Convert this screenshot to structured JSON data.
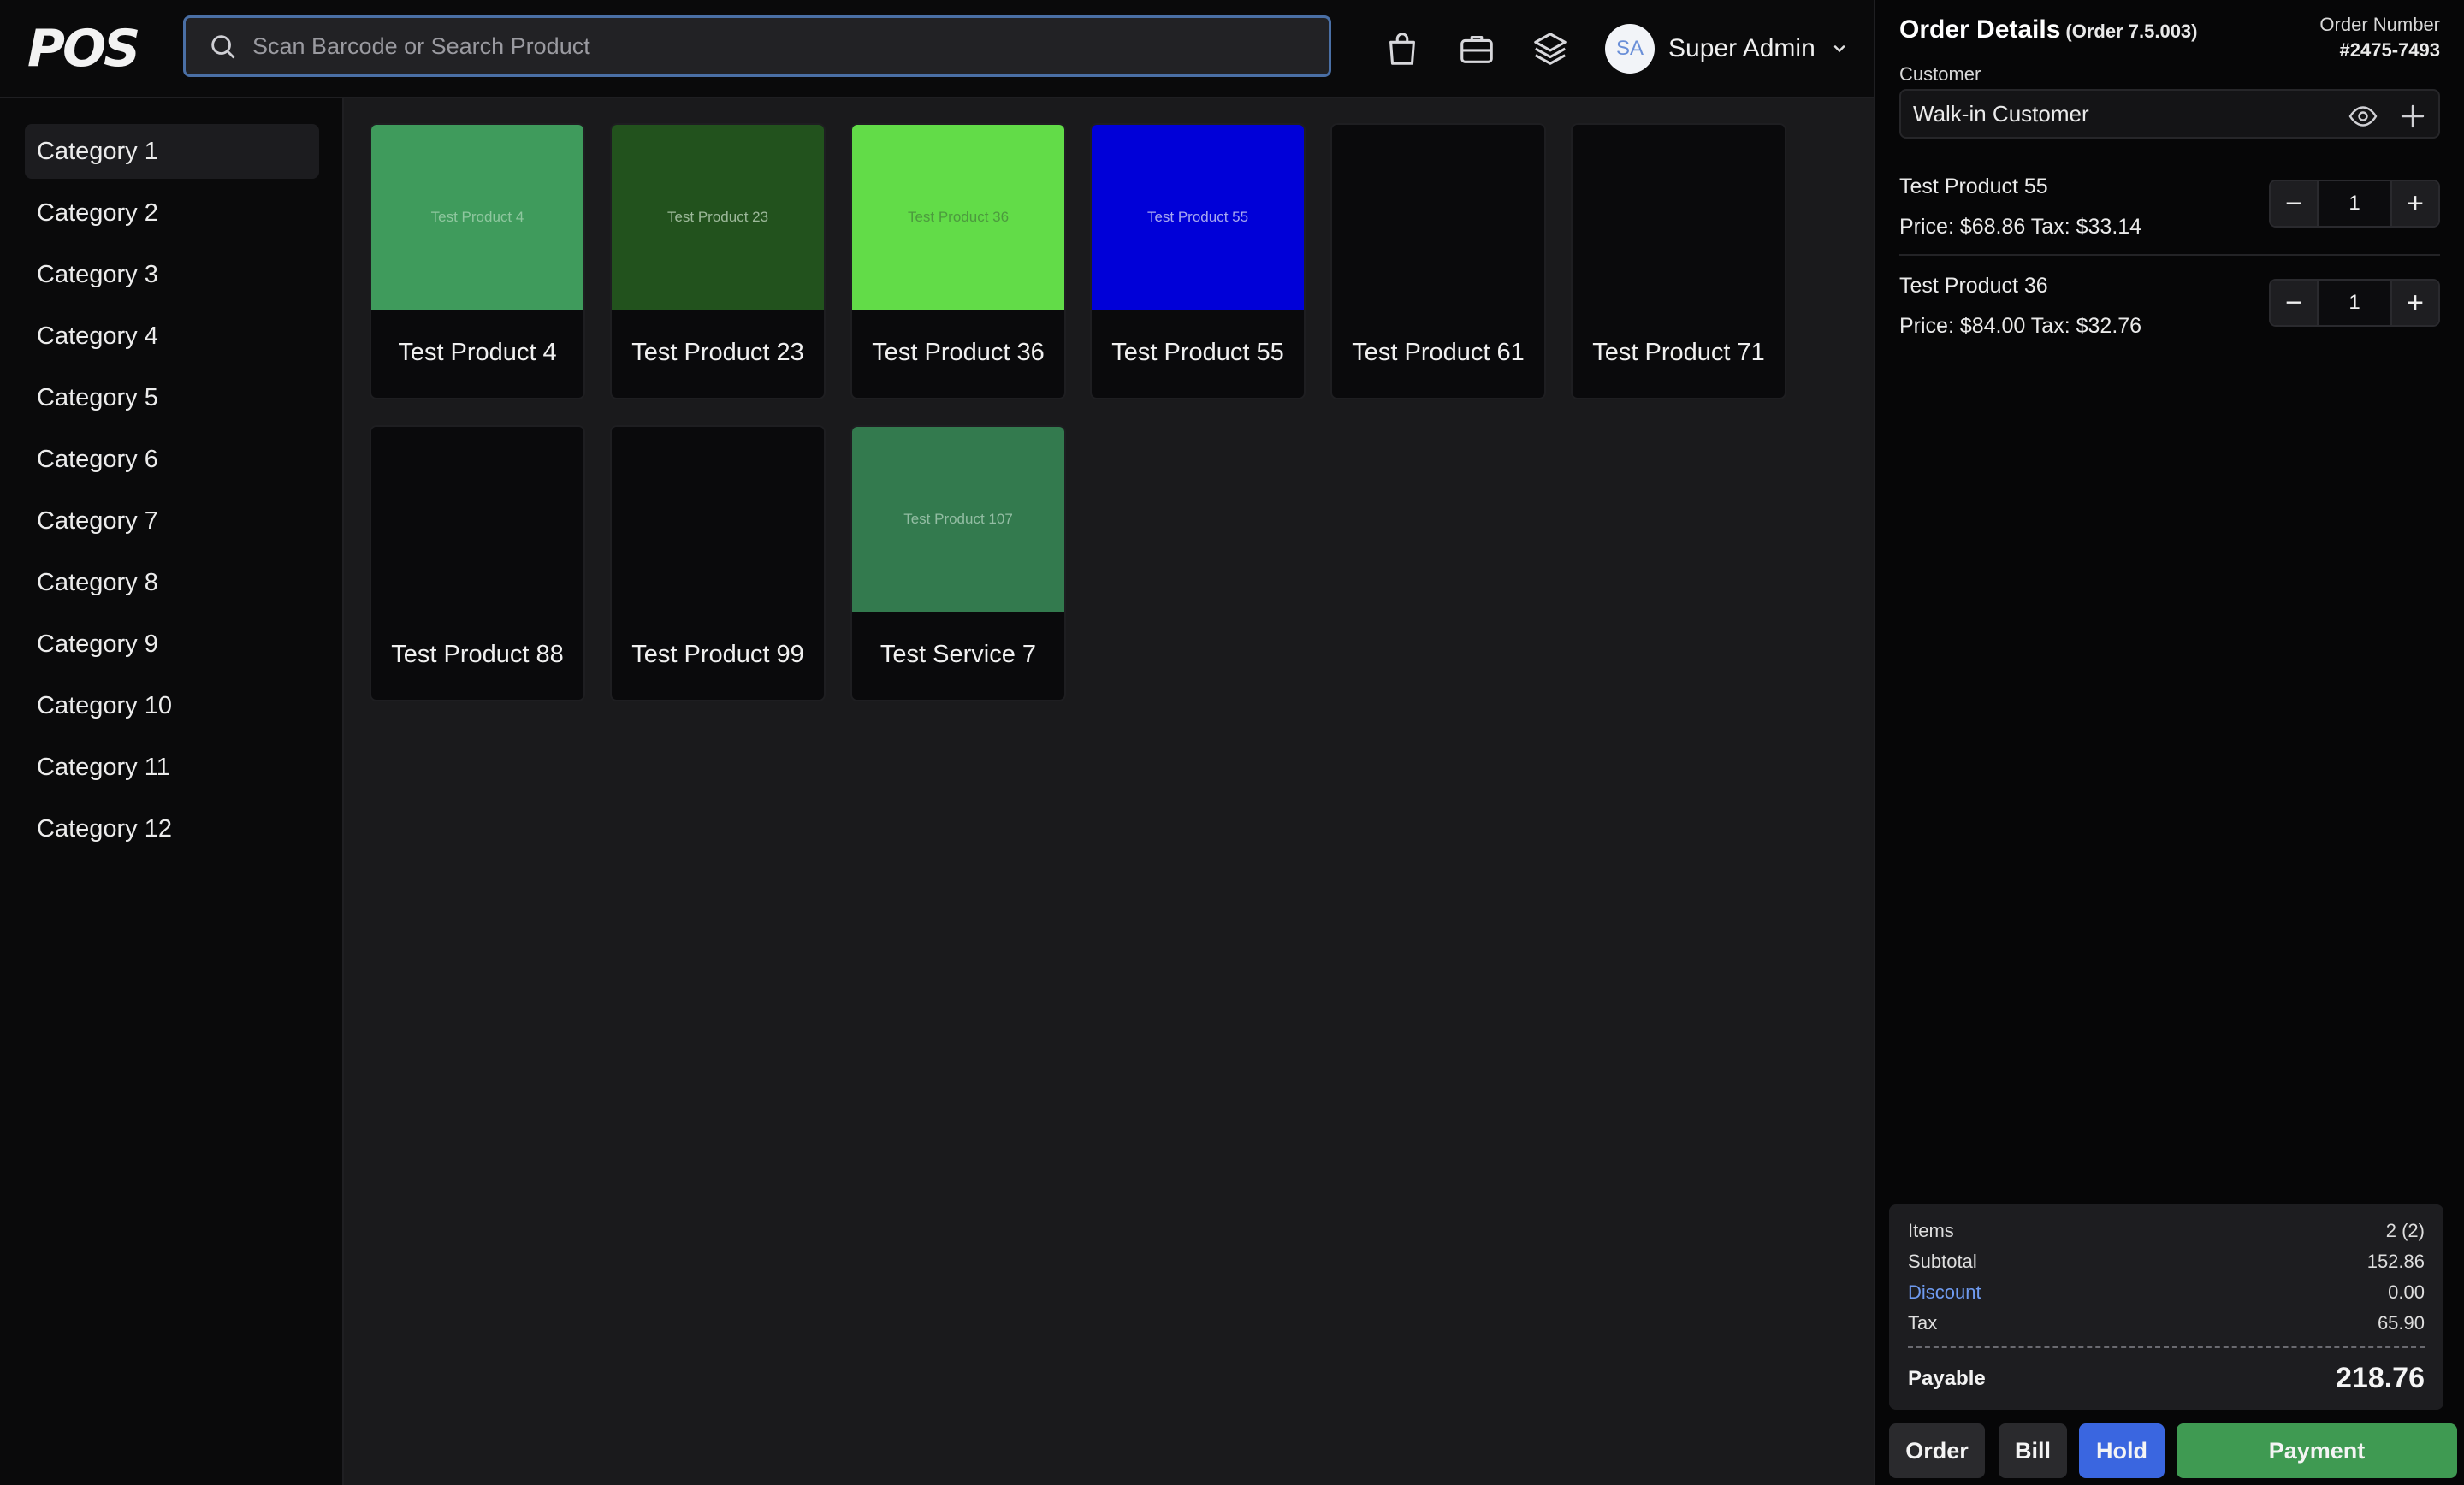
{
  "header": {
    "logo": "POS",
    "search_placeholder": "Scan Barcode or Search Product",
    "icons": [
      "shopping-bag-icon",
      "briefcase-icon",
      "layers-icon"
    ],
    "user": {
      "initials": "SA",
      "name": "Super Admin"
    }
  },
  "sidebar": {
    "categories": [
      {
        "label": "Category 1",
        "active": true
      },
      {
        "label": "Category 2"
      },
      {
        "label": "Category 3"
      },
      {
        "label": "Category 4"
      },
      {
        "label": "Category 5"
      },
      {
        "label": "Category 6"
      },
      {
        "label": "Category 7"
      },
      {
        "label": "Category 8"
      },
      {
        "label": "Category 9"
      },
      {
        "label": "Category 10"
      },
      {
        "label": "Category 11"
      },
      {
        "label": "Category 12"
      }
    ]
  },
  "products": [
    {
      "name": "Test Product 4",
      "thumb_text": "Test Product 4",
      "color": "#3f9b5c",
      "thumb_text_color": "#8fc79f"
    },
    {
      "name": "Test Product 23",
      "thumb_text": "Test Product 23",
      "color": "#22521d",
      "thumb_text_color": "#9db99a"
    },
    {
      "name": "Test Product 36",
      "thumb_text": "Test Product 36",
      "color": "#62dc48",
      "thumb_text_color": "#4c9a3e"
    },
    {
      "name": "Test Product 55",
      "thumb_text": "Test Product 55",
      "color": "#0000d8",
      "thumb_text_color": "#a8a8f0"
    },
    {
      "name": "Test Product 61",
      "thumb_text": "",
      "color": "#0a0a0c",
      "thumb_text_color": "#0a0a0c"
    },
    {
      "name": "Test Product 71",
      "thumb_text": "",
      "color": "#0a0a0c",
      "thumb_text_color": "#0a0a0c"
    },
    {
      "name": "Test Product 88",
      "thumb_text": "",
      "color": "#0a0a0c",
      "thumb_text_color": "#0a0a0c"
    },
    {
      "name": "Test Product 99",
      "thumb_text": "",
      "color": "#0a0a0c",
      "thumb_text_color": "#0a0a0c"
    },
    {
      "name": "Test Service 7",
      "thumb_text": "Test Product 107",
      "color": "#337a4e",
      "thumb_text_color": "#93bda3"
    }
  ],
  "order": {
    "title": "Order Details",
    "version": "(Order 7.5.003)",
    "number_label": "Order Number",
    "number": "#2475-7493",
    "customer_label": "Customer",
    "customer": "Walk-in Customer",
    "items": [
      {
        "name": "Test Product 55",
        "price_line": "Price: $68.86 Tax: $33.14",
        "qty": "1"
      },
      {
        "name": "Test Product 36",
        "price_line": "Price: $84.00 Tax: $32.76",
        "qty": "1"
      }
    ],
    "totals": {
      "items_label": "Items",
      "items_value": "2 (2)",
      "subtotal_label": "Subtotal",
      "subtotal_value": "152.86",
      "discount_label": "Discount",
      "discount_value": "0.00",
      "tax_label": "Tax",
      "tax_value": "65.90",
      "payable_label": "Payable",
      "payable_value": "218.76"
    },
    "actions": {
      "order": "Order",
      "bill": "Bill",
      "hold": "Hold",
      "payment": "Payment"
    }
  },
  "colors": {
    "accent_blue": "#3a66e0",
    "payment_green": "#3f9a52",
    "link_blue": "#6f9bf0"
  }
}
